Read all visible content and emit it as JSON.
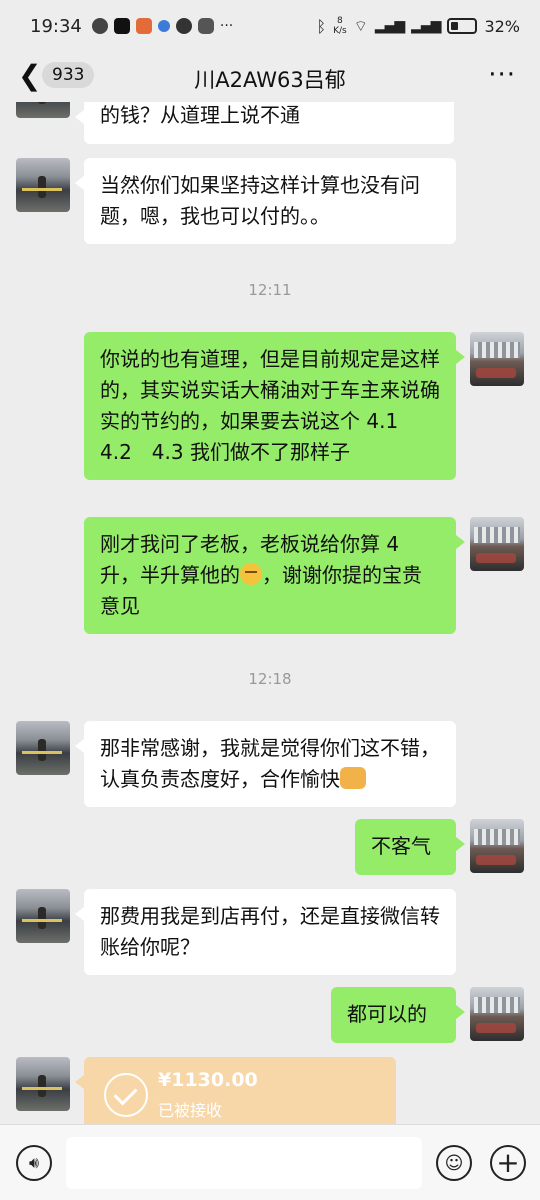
{
  "status_bar": {
    "time": "19:34",
    "net_speed_value": "8",
    "net_speed_unit": "K/s",
    "battery": "32%"
  },
  "header": {
    "back_icon": "chevron-left-icon",
    "unread_count": "933",
    "title": "川A2AW63吕郁",
    "more": "···"
  },
  "messages": [
    {
      "side": "left",
      "text": "的钱？从道理上说不通"
    },
    {
      "side": "left",
      "text": "当然你们如果坚持这样计算也没有问题，嗯，我也可以付的。。"
    },
    {
      "type": "time",
      "text": "12:11"
    },
    {
      "side": "right",
      "text": "你说的也有道理，但是目前规定是这样的，其实说实话大桶油对于车主来说确实的节约的，如果要去说这个 4.1　 4.2　4.3 我们做不了那样子"
    },
    {
      "side": "right",
      "text_a": "刚才我问了老板，老板说给你算 4 升，半升算他的",
      "text_b": "，谢谢你提的宝贵意见"
    },
    {
      "type": "time",
      "text": "12:18"
    },
    {
      "side": "left",
      "text": "那非常感谢，我就是觉得你们这不错，认真负责态度好，合作愉快"
    },
    {
      "side": "right",
      "text": "不客气"
    },
    {
      "side": "left",
      "text": "那费用我是到店再付，还是直接微信转账给你呢？"
    },
    {
      "side": "right",
      "text": "都可以的"
    },
    {
      "side": "left",
      "type": "transfer",
      "amount": "¥1130.00",
      "status": "已被接收"
    }
  ],
  "input_bar": {
    "voice_icon": "voice-icon",
    "emoji_icon": "smile-icon",
    "plus_icon": "plus-icon"
  }
}
